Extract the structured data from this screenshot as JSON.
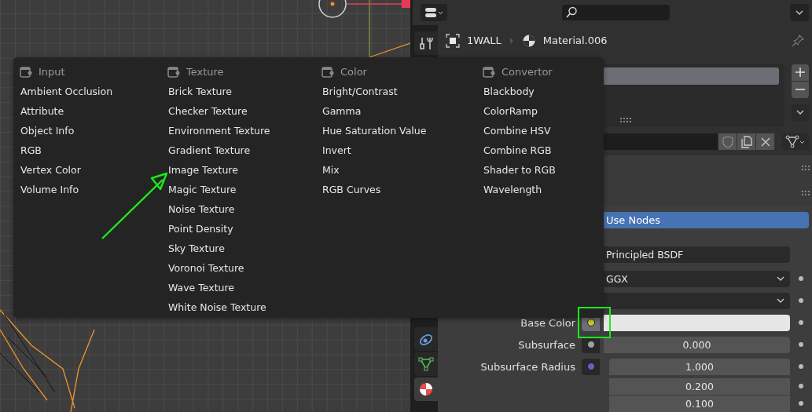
{
  "properties": {
    "tabs": [
      {
        "kind": "tool",
        "selected": false
      },
      {
        "kind": "physics",
        "selected": false
      },
      {
        "kind": "mesh",
        "selected": false
      },
      {
        "kind": "material",
        "selected": true
      }
    ],
    "breadcrumb": {
      "object": "1WALL",
      "material": "Material.006"
    },
    "use_nodes": {
      "label": "Use Nodes",
      "on": true
    },
    "surface": {
      "value": "Principled BSDF"
    },
    "distribution": {
      "value": "GGX"
    },
    "inputs": [
      {
        "label": "Base Color",
        "kind": "color",
        "color": "#c8c836"
      },
      {
        "label": "Subsurface",
        "kind": "number",
        "color": "#a1a1a1",
        "values": [
          "0.000"
        ]
      },
      {
        "label": "Subsurface Radius",
        "kind": "vector",
        "color": "#6363c7",
        "values": [
          "1.000",
          "0.200",
          "0.100"
        ]
      }
    ]
  },
  "menu": {
    "columns": [
      {
        "title": "Input",
        "items": [
          "Ambient Occlusion",
          "Attribute",
          "Object Info",
          "RGB",
          "Vertex Color",
          "Volume Info"
        ]
      },
      {
        "title": "Texture",
        "items": [
          "Brick Texture",
          "Checker Texture",
          "Environment Texture",
          "Gradient Texture",
          "Image Texture",
          "Magic Texture",
          "Noise Texture",
          "Point Density",
          "Sky Texture",
          "Voronoi Texture",
          "Wave Texture",
          "White Noise Texture"
        ]
      },
      {
        "title": "Color",
        "items": [
          "Bright/Contrast",
          "Gamma",
          "Hue Saturation Value",
          "Invert",
          "Mix",
          "RGB Curves"
        ]
      },
      {
        "title": "Convertor",
        "items": [
          "Blackbody",
          "ColorRamp",
          "Combine HSV",
          "Combine RGB",
          "Shader to RGB",
          "Wavelength"
        ]
      }
    ]
  }
}
